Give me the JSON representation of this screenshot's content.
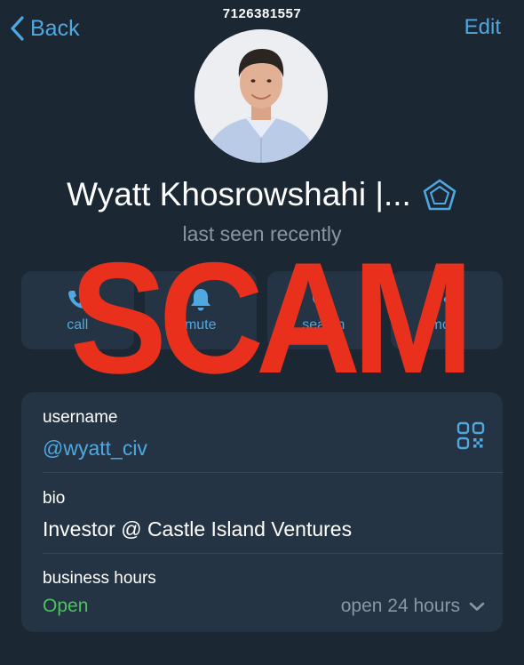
{
  "header": {
    "back_label": "Back",
    "edit_label": "Edit",
    "phone": "7126381557"
  },
  "profile": {
    "name": "Wyatt Khosrowshahi |...",
    "status": "last seen recently"
  },
  "actions": [
    {
      "label": "call",
      "icon": "phone-icon"
    },
    {
      "label": "mute",
      "icon": "bell-icon"
    },
    {
      "label": "search",
      "icon": "search-icon"
    },
    {
      "label": "more",
      "icon": "more-icon"
    }
  ],
  "overlay": {
    "text": "SCAM",
    "color": "#e8301c"
  },
  "info": {
    "username_label": "username",
    "username": "@wyatt_civ",
    "bio_label": "bio",
    "bio": "Investor @ Castle Island Ventures",
    "hours_label": "business hours",
    "open_status": "Open",
    "hours": "open 24 hours"
  },
  "colors": {
    "background": "#1b2733",
    "card": "#243444",
    "accent": "#4fa8e0",
    "open": "#4cc35e",
    "muted": "#8a97a3"
  }
}
